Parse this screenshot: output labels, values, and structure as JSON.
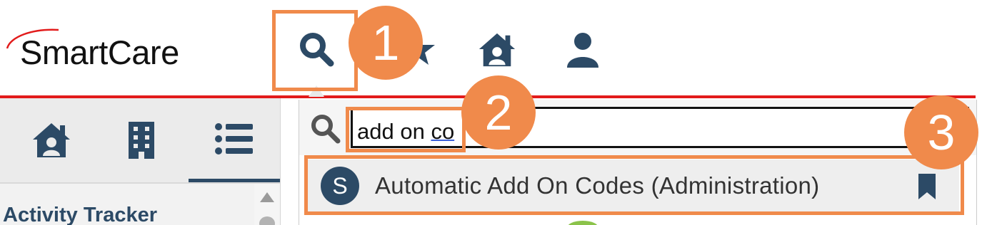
{
  "app": {
    "logo_text": "SmartCare"
  },
  "header": {
    "icons": [
      "search-icon",
      "star-icon",
      "home-icon",
      "user-icon"
    ]
  },
  "callouts": {
    "one": "1",
    "two": "2",
    "three": "3"
  },
  "sidebar": {
    "tabs": [
      "home-icon",
      "building-icon",
      "list-icon"
    ],
    "active_tab": "list-icon",
    "section_title": "Activity Tracker"
  },
  "search": {
    "query_plain": "add on ",
    "query_underlined": "co",
    "results": [
      {
        "avatar_letter": "S",
        "label": "Automatic Add On Codes (Administration)",
        "icon": "bookmark-icon"
      }
    ]
  },
  "colors": {
    "brand_navy": "#2c4a66",
    "callout_orange": "#f08a4b",
    "header_rule_red": "#e21b1b"
  }
}
